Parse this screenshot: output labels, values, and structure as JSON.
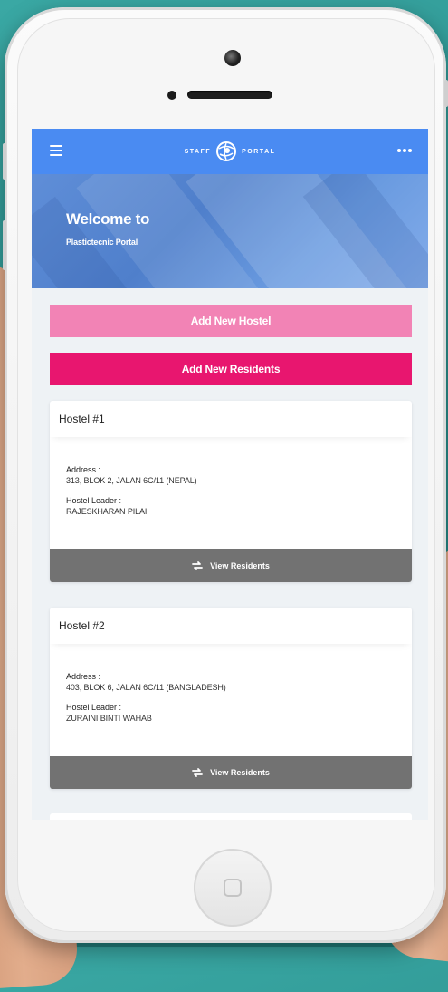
{
  "app": {
    "brand_left": "STAFF",
    "brand_right": "PORTAL"
  },
  "hero": {
    "title": "Welcome to",
    "subtitle": "Plastictecnic Portal"
  },
  "actions": {
    "add_hostel": "Add New Hostel",
    "add_residents": "Add New Residents"
  },
  "hostels": [
    {
      "title": "Hostel #1",
      "address_label": "Address :",
      "address": "313, BLOK 2, JALAN 6C/11 (NEPAL)",
      "leader_label": "Hostel Leader :",
      "leader": "RAJESKHARAN PILAI",
      "view_label": "View Residents"
    },
    {
      "title": "Hostel #2",
      "address_label": "Address :",
      "address": "403, BLOK 6, JALAN 6C/11 (BANGLADESH)",
      "leader_label": "Hostel Leader :",
      "leader": "ZURAINI BINTI WAHAB",
      "view_label": "View Residents"
    }
  ],
  "icons": {
    "menu": "menu-icon",
    "more": "more-icon",
    "logo": "globe-logo-icon",
    "view": "swap-icon",
    "home": "home-button-icon"
  },
  "colors": {
    "appbar": "#4a8bf2",
    "add_hostel": "#f283b5",
    "add_residents": "#e8166f",
    "view_button": "#727272",
    "background": "#2a8f8c"
  }
}
